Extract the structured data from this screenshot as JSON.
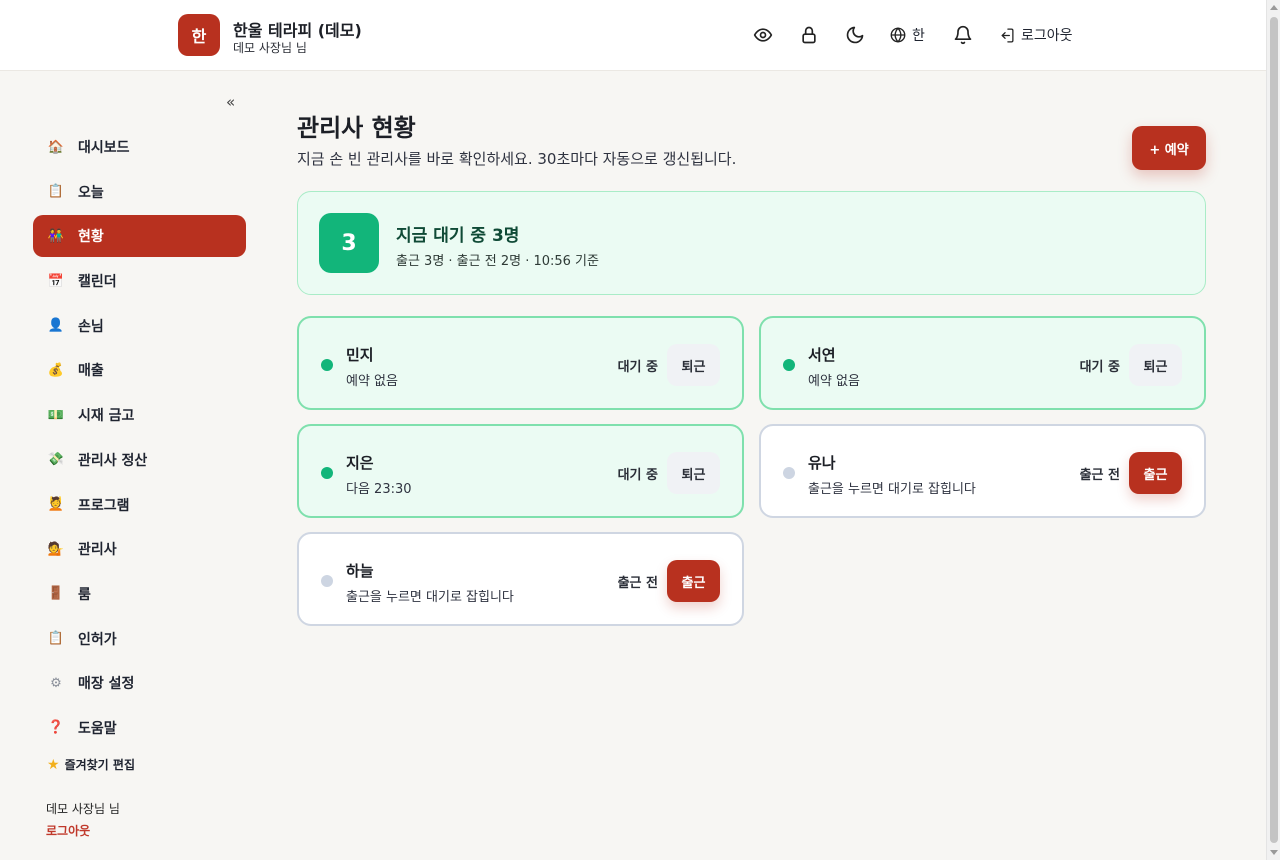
{
  "header": {
    "logo_char": "한",
    "title": "한울 테라피 (데모)",
    "subtitle": "데모 사장님 님",
    "lang_label": "한",
    "logout_label": "로그아웃"
  },
  "sidebar": {
    "collapse_label": "«",
    "items": [
      {
        "label": "대시보드",
        "icon": "🏠"
      },
      {
        "label": "오늘",
        "icon": "📋"
      },
      {
        "label": "현황",
        "icon": "👫"
      },
      {
        "label": "캘린더",
        "icon": "📅"
      },
      {
        "label": "손님",
        "icon": "👤"
      },
      {
        "label": "매출",
        "icon": "💰"
      },
      {
        "label": "시재 금고",
        "icon": "💵"
      },
      {
        "label": "관리사 정산",
        "icon": "💸"
      },
      {
        "label": "프로그램",
        "icon": "💆"
      },
      {
        "label": "관리사",
        "icon": "💁"
      },
      {
        "label": "룸",
        "icon": "🚪"
      },
      {
        "label": "인허가",
        "icon": "📋"
      },
      {
        "label": "매장 설정",
        "icon": "⚙"
      },
      {
        "label": "도움말",
        "icon": "❓"
      }
    ],
    "favorites_label": "즐겨찾기 편집",
    "user_label": "데모 사장님 님",
    "logout_label": "로그아웃"
  },
  "main": {
    "title": "관리사 현황",
    "description": "지금 손 빈 관리사를 바로 확인하세요. 30초마다 자동으로 갱신됩니다.",
    "reserve_button": "+ 예약",
    "summary": {
      "count": "3",
      "title": "지금 대기 중 3명",
      "subtitle": "출근 3명 · 출근 전 2명 · 10:56 기준"
    },
    "cards": [
      {
        "name": "민지",
        "note": "예약 없음",
        "status": "대기 중",
        "button": "퇴근"
      },
      {
        "name": "서연",
        "note": "예약 없음",
        "status": "대기 중",
        "button": "퇴근"
      },
      {
        "name": "지은",
        "note": "다음 23:30",
        "status": "대기 중",
        "button": "퇴근"
      },
      {
        "name": "유나",
        "note": "출근을 누르면 대기로 잡힙니다",
        "status": "출근 전",
        "button": "출근"
      },
      {
        "name": "하늘",
        "note": "출근을 누르면 대기로 잡힙니다",
        "status": "출근 전",
        "button": "출근"
      }
    ]
  },
  "colors": {
    "brand": "#b8311f",
    "waiting_green": "#12b57a",
    "waiting_bg": "#ebfbf3"
  }
}
